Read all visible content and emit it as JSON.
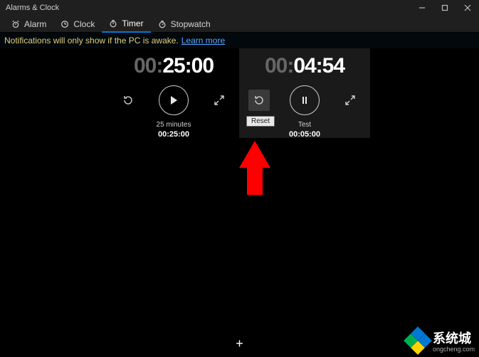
{
  "window": {
    "title": "Alarms & Clock"
  },
  "tabs": {
    "alarm": "Alarm",
    "clock": "Clock",
    "timer": "Timer",
    "stopwatch": "Stopwatch"
  },
  "notification": {
    "message": "Notifications will only show if the PC is awake.",
    "link": "Learn more"
  },
  "timers": [
    {
      "hours_prefix": "00:",
      "main": "25:00",
      "name": "25 minutes",
      "total": "00:25:00"
    },
    {
      "hours_prefix": "00:",
      "main": "04:54",
      "name": "Test",
      "total": "00:05:00"
    }
  ],
  "tooltip": {
    "reset": "Reset"
  },
  "add_button": "+",
  "watermark": {
    "text": "系统城",
    "sub": "ongcheng.com"
  }
}
